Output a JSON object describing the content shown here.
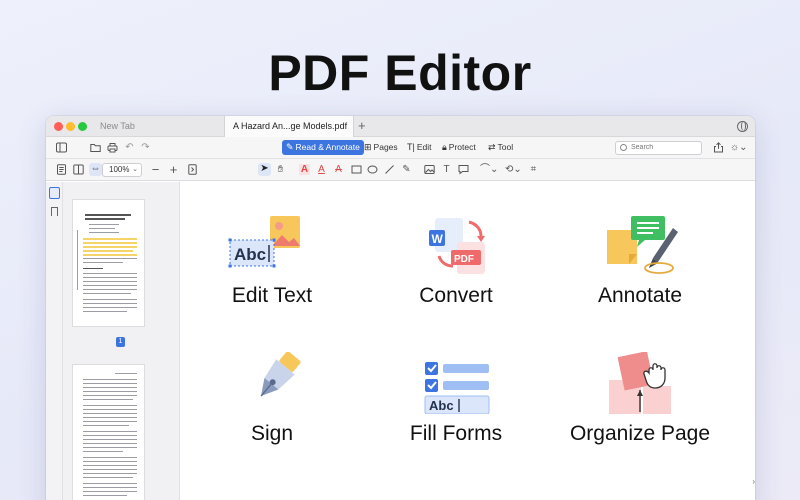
{
  "hero": {
    "title": "PDF Editor"
  },
  "tabs": [
    {
      "label": "New Tab",
      "active": false
    },
    {
      "label": "A Hazard An...ge Models.pdf",
      "active": true
    }
  ],
  "toolbar": {
    "modes": [
      {
        "label": "Read & Annotate",
        "glyph": "✎",
        "active": true
      },
      {
        "label": "Pages",
        "glyph": "⊞",
        "active": false
      },
      {
        "label": "Edit",
        "glyph": "T|",
        "active": false
      },
      {
        "label": "Protect",
        "glyph": "🔒︎",
        "active": false
      },
      {
        "label": "Tool",
        "glyph": "⇄",
        "active": false
      }
    ],
    "search_placeholder": "Search",
    "zoom": "100%"
  },
  "sidebar": {
    "current_page": "1"
  },
  "features": [
    {
      "label": "Edit Text",
      "icon": "edit-text-icon"
    },
    {
      "label": "Convert",
      "icon": "convert-icon"
    },
    {
      "label": "Annotate",
      "icon": "annotate-icon"
    },
    {
      "label": "Sign",
      "icon": "sign-pen-icon"
    },
    {
      "label": "Fill Forms",
      "icon": "fill-forms-icon"
    },
    {
      "label": "Organize Page",
      "icon": "organize-page-icon"
    }
  ],
  "icon_text": {
    "abc": "Abc",
    "word": "W",
    "pdf": "PDF"
  },
  "colors": {
    "accent": "#3c74e0",
    "highlight": "#f5d46a",
    "brand_red": "#ef6a6a",
    "brand_green": "#3fbf62"
  }
}
